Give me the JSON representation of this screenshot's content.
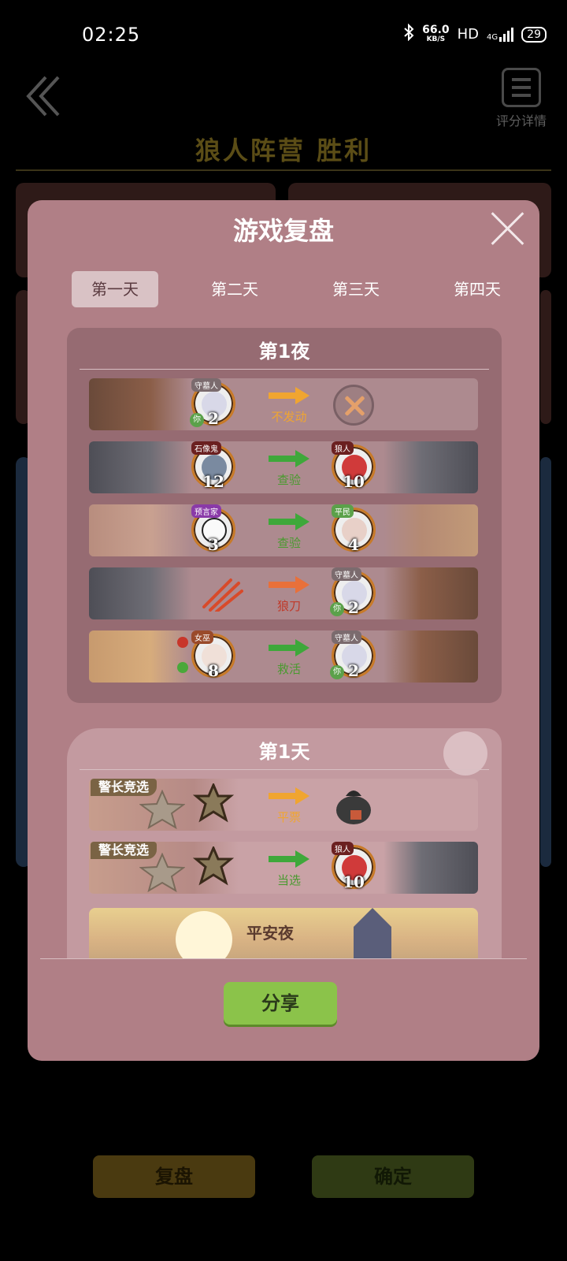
{
  "status_bar": {
    "time": "02:25",
    "net_speed": "66.0",
    "net_unit": "KB/S",
    "hd": "HD",
    "signal": "4G",
    "battery": "29"
  },
  "background": {
    "score_label": "评分详情",
    "result_title": "狼人阵营  胜利",
    "replay_button": "复盘",
    "confirm_button": "确定"
  },
  "modal": {
    "title": "游戏复盘",
    "tabs": [
      "第一天",
      "第二天",
      "第三天",
      "第四天"
    ],
    "active_tab": 0,
    "night": {
      "title": "第1夜",
      "rows": [
        {
          "actor_role": "守墓人",
          "actor_num": "2",
          "actor_you": "你",
          "action": "不发动",
          "target_role": "",
          "target_num": ""
        },
        {
          "actor_role": "石像鬼",
          "actor_num": "12",
          "action": "查验",
          "target_role": "狼人",
          "target_num": "10"
        },
        {
          "actor_role": "预言家",
          "actor_num": "3",
          "action": "查验",
          "target_role": "平民",
          "target_num": "4"
        },
        {
          "actor_role": "",
          "actor_num": "",
          "action": "狼刀",
          "target_role": "守墓人",
          "target_num": "2",
          "target_you": "你"
        },
        {
          "actor_role": "女巫",
          "actor_num": "8",
          "action": "救活",
          "target_role": "守墓人",
          "target_num": "2",
          "target_you": "你"
        }
      ]
    },
    "day": {
      "title": "第1天",
      "rows": [
        {
          "tag": "警长竞选",
          "badge_text": "警长",
          "action": "平票"
        },
        {
          "tag": "警长竞选",
          "badge_text": "警长",
          "action": "当选",
          "target_role": "狼人",
          "target_num": "10"
        }
      ],
      "peace_night": "平安夜"
    },
    "share_button": "分享"
  },
  "colors": {
    "modal_bg": "#b07f86",
    "night_panel": "#966b72",
    "arrow_orange": "#f0a530",
    "arrow_green": "#4a9a30",
    "arrow_red": "#c03a2a",
    "share_green": "#8bc34a"
  }
}
